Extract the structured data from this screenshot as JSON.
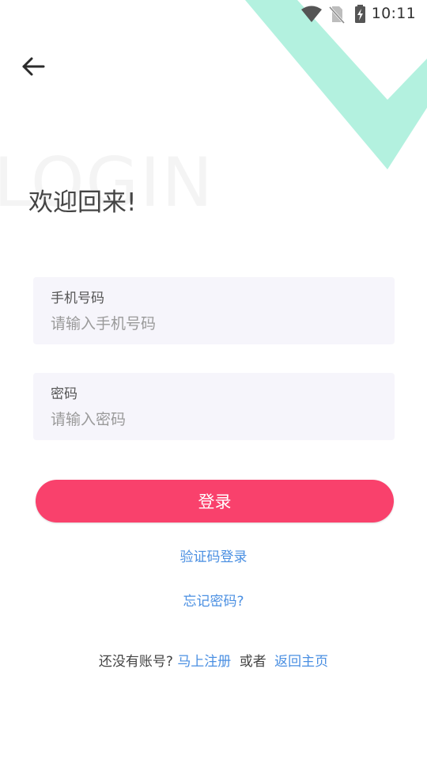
{
  "status_bar": {
    "time": "10:11",
    "icons": [
      "wifi-icon",
      "no-sim-icon",
      "battery-charging-icon"
    ]
  },
  "header": {
    "back_icon": "arrow-left-icon"
  },
  "hero": {
    "watermark": "LOGIN",
    "title": "欢迎回来!"
  },
  "form": {
    "phone": {
      "label": "手机号码",
      "placeholder": "请输入手机号码",
      "value": ""
    },
    "password": {
      "label": "密码",
      "placeholder": "请输入密码",
      "value": ""
    },
    "login_button": "登录"
  },
  "links": {
    "sms_login": "验证码登录",
    "forgot_password": "忘记密码?"
  },
  "footer": {
    "prompt": "还没有账号?",
    "register": "马上注册",
    "or": "或者",
    "home": "返回主页"
  },
  "colors": {
    "accent": "#f9416c",
    "link": "#4a8fe2",
    "decoration": "#b3f1df",
    "field_background": "#f6f5fb"
  }
}
